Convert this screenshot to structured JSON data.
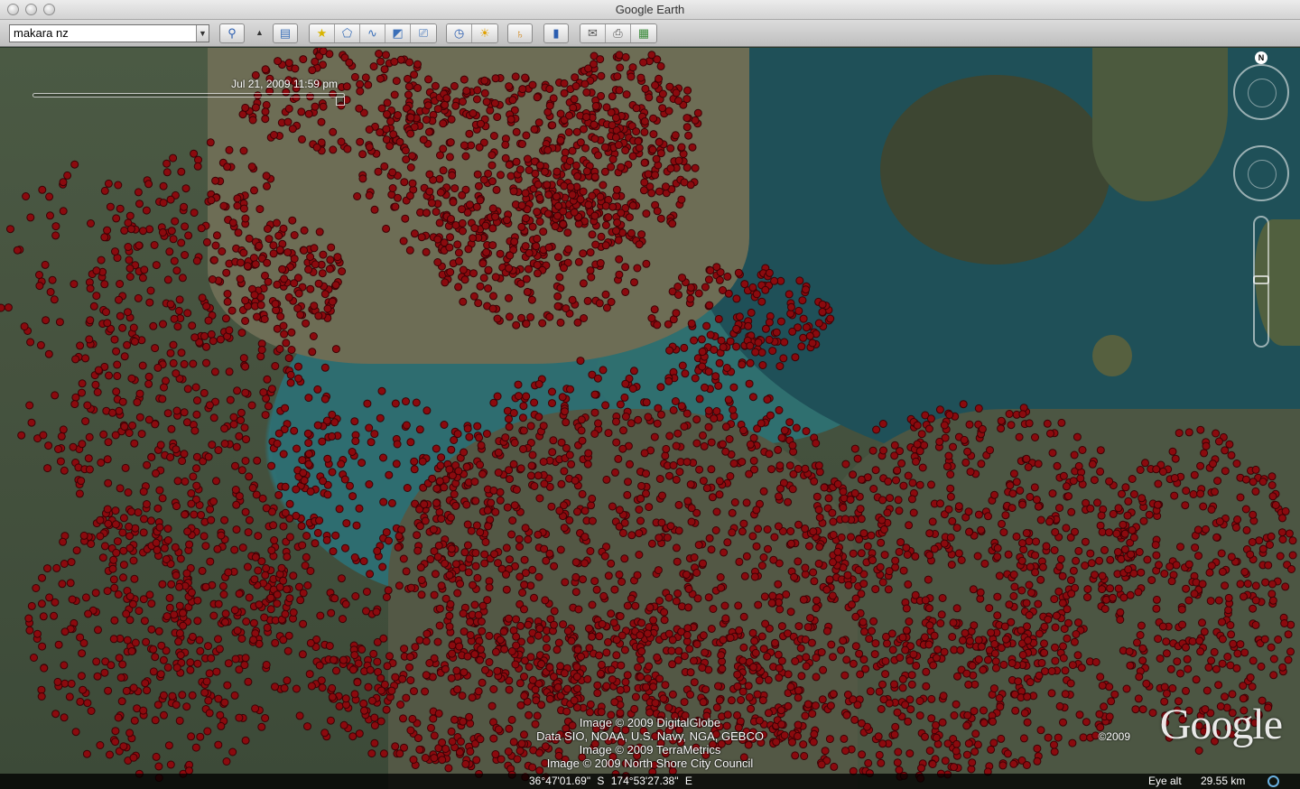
{
  "window": {
    "title": "Google Earth"
  },
  "toolbar": {
    "search_value": "makara nz",
    "buttons": [
      "search-icon",
      "collapse-arrow-icon",
      "sidebar-toggle-icon",
      "add-placemark-icon",
      "add-polygon-icon",
      "add-path-icon",
      "add-image-overlay-icon",
      "record-tour-icon",
      "historical-imagery-icon",
      "sunlight-icon",
      "switch-to-sky-icon",
      "ruler-icon",
      "email-icon",
      "print-icon",
      "view-in-maps-icon"
    ]
  },
  "map": {
    "time_label": "Jul 21, 2009  11:59 pm",
    "compass_letter": "N",
    "attribution": [
      "Image © 2009 DigitalGlobe",
      "Data SIO, NOAA, U.S. Navy, NGA, GEBCO",
      "Image © 2009 TerraMetrics",
      "Image © 2009 North Shore City Council"
    ],
    "logo_copyright": "©2009",
    "logo_text": "Google",
    "placemark_color": "#8b0a0e"
  },
  "status": {
    "coordinates": "36°47'01.69\" S   174°53'27.38\" E",
    "eye_alt_label": "Eye alt",
    "eye_alt_value": "29.55 km"
  }
}
